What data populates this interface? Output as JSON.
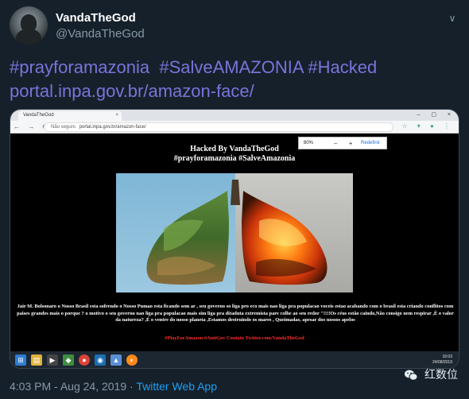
{
  "tweet": {
    "display_name": "VandaTheGod",
    "handle": "@VandaTheGod",
    "text_line1_hashtag1": "#prayforamazonia",
    "text_line1_hashtag2": "#SalveAMAZONIA",
    "text_line1_hashtag3": "#Hacked",
    "text_line2_link": "portal.inpa.gov.br/amazon-face/",
    "time": "4:03 PM",
    "date": "Aug 24, 2019",
    "separator": "·",
    "app": "Twitter Web App",
    "caret_icon": "chevron-down-icon"
  },
  "browser": {
    "tab_title": "VandaTheGod",
    "tab_close": "×",
    "window_controls": "–  ▢  ×",
    "nav": "←  →  ⟳",
    "address_secure": "Não seguro",
    "address_url": "portal.inpa.gov.br/amazon-face/",
    "zoom_value": "80%",
    "zoom_minus": "–",
    "zoom_plus": "+",
    "zoom_reset": "Redefinir"
  },
  "page": {
    "title": "Hacked By VandaTheGod",
    "tags": "#prayforamazonia #SalveAmazonia",
    "body": "Jair M. Bolsonaro o Nosso Brasil esta sofrendo o Nosso Pumao esta ficando sem ar , seu governo so liga pro eco mais nao liga pra populacao voceis estao acabando com o brasil esta criando conflitos com paises grandes mais o porque ? o motivo o seu governo nao liga pra populacao mais sim liga pra ditaduta extremista pare colhe ao seu redor \"!!!!Os céus estão caindo,Não consigo nem respirar ,É o valor da natureza? ,É o ventre do nosso planeta ,Estamos destruindo os mares , Queimadas, apesar dos nossos apelos",
    "red_line": "#PlayForAmazon #AntiGov Contato Twitter.com/VandaTheGod"
  },
  "taskbar": {
    "clock_time": "16:03",
    "clock_date": "24/08/2019"
  },
  "watermark": {
    "label": "红数位"
  },
  "colors": {
    "background": "#15202b",
    "link": "#1da1f2",
    "hashtag": "#7b73d9",
    "muted": "#8899a6",
    "hack_red": "#ff2a2a"
  }
}
